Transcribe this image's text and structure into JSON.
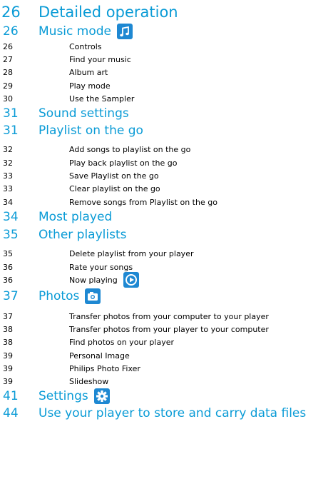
{
  "toc": [
    {
      "level": 1,
      "page": "26",
      "title": "Detailed operation"
    },
    {
      "level": 2,
      "page": "26",
      "title": "Music mode",
      "icon": "music-note-icon"
    },
    {
      "level": 3,
      "page": "26",
      "title": "Controls"
    },
    {
      "level": 3,
      "page": "27",
      "title": "Find your music"
    },
    {
      "level": 3,
      "page": "28",
      "title": "Album art"
    },
    {
      "level": 3,
      "page": "29",
      "title": "Play mode"
    },
    {
      "level": 3,
      "page": "30",
      "title": "Use the Sampler"
    },
    {
      "level": 2,
      "page": "31",
      "title": "Sound settings"
    },
    {
      "level": 2,
      "page": "31",
      "title": "Playlist on the go"
    },
    {
      "level": 3,
      "page": "32",
      "title": "Add songs to playlist on the go"
    },
    {
      "level": 3,
      "page": "32",
      "title": "Play back playlist on the go"
    },
    {
      "level": 3,
      "page": "33",
      "title": "Save Playlist on the go"
    },
    {
      "level": 3,
      "page": "33",
      "title": "Clear playlist on the go"
    },
    {
      "level": 3,
      "page": "34",
      "title": "Remove songs from Playlist on the go"
    },
    {
      "level": 2,
      "page": "34",
      "title": "Most played"
    },
    {
      "level": 2,
      "page": "35",
      "title": "Other playlists"
    },
    {
      "level": 3,
      "page": "35",
      "title": "Delete playlist from your player"
    },
    {
      "level": 3,
      "page": "36",
      "title": "Rate your songs"
    },
    {
      "level": 3,
      "page": "36",
      "title": "Now playing",
      "icon": "play-circle-icon"
    },
    {
      "level": 2,
      "page": "37",
      "title": "Photos",
      "icon": "camera-icon"
    },
    {
      "level": 3,
      "page": "37",
      "title": "Transfer photos from your computer to your player"
    },
    {
      "level": 3,
      "page": "38",
      "title": "Transfer photos from your player to your computer"
    },
    {
      "level": 3,
      "page": "38",
      "title": "Find photos on your player"
    },
    {
      "level": 3,
      "page": "39",
      "title": "Personal Image"
    },
    {
      "level": 3,
      "page": "39",
      "title": "Philips Photo Fixer"
    },
    {
      "level": 3,
      "page": "39",
      "title": "Slideshow"
    },
    {
      "level": 2,
      "page": "41",
      "title": "Settings",
      "icon": "gear-icon"
    },
    {
      "level": 2,
      "page": "44",
      "title": "Use your player to store and carry data files"
    }
  ],
  "colors": {
    "heading": "#0a9bd6",
    "icon_bg": "#1e88d2",
    "text": "#000000"
  }
}
